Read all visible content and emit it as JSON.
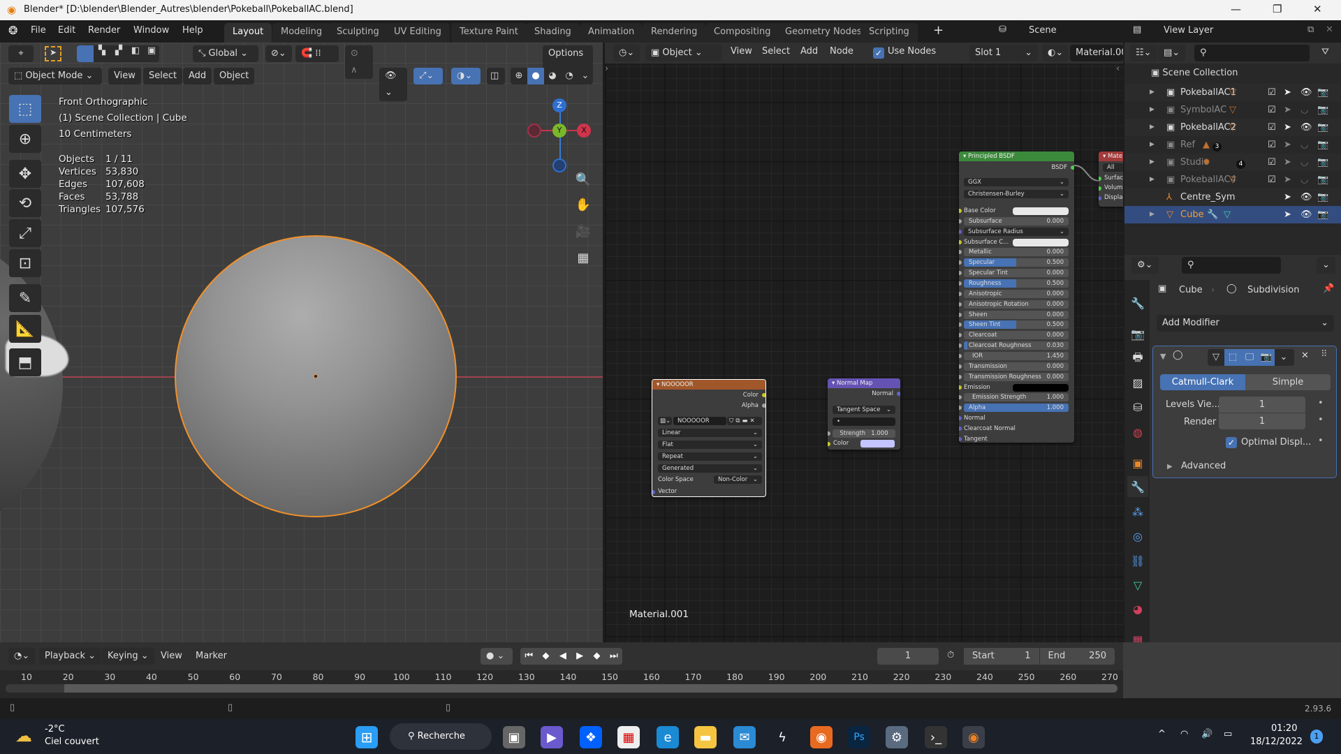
{
  "window": {
    "title": "Blender* [D:\\blender\\Blender_Autres\\blender\\Pokeball\\PokeballAC.blend]"
  },
  "menu": [
    "File",
    "Edit",
    "Render",
    "Window",
    "Help"
  ],
  "workspaces": [
    "Layout",
    "Modeling",
    "Sculpting",
    "UV Editing",
    "Texture Paint",
    "Shading",
    "Animation",
    "Rendering",
    "Compositing",
    "Geometry Nodes",
    "Scripting"
  ],
  "active_workspace": "Layout",
  "scene": "Scene",
  "view_layer": "View Layer",
  "viewport": {
    "transform": "Global",
    "options": "Options",
    "mode": "Object Mode",
    "menus": [
      "View",
      "Select",
      "Add",
      "Object"
    ],
    "overlay": {
      "view": "Front Orthographic",
      "collection": "(1) Scene Collection | Cube",
      "scale": "10 Centimeters",
      "stats": [
        {
          "label": "Objects",
          "value": "1 / 11"
        },
        {
          "label": "Vertices",
          "value": "53,830"
        },
        {
          "label": "Edges",
          "value": "107,608"
        },
        {
          "label": "Faces",
          "value": "53,788"
        },
        {
          "label": "Triangles",
          "value": "107,576"
        }
      ]
    },
    "gizmo": {
      "z": "Z",
      "y": "Y",
      "x": "X"
    },
    "selection_color": "#f0902a"
  },
  "node_editor": {
    "type": "Object",
    "menus": [
      "View",
      "Select",
      "Add",
      "Node"
    ],
    "use_nodes": "Use Nodes",
    "use_nodes_checked": true,
    "slot": "Slot 1",
    "material": "Material.00",
    "material_label": "Material.001",
    "image_node": {
      "title": "NOOOOOR",
      "outputs": [
        "Color",
        "Alpha"
      ],
      "image": "NOOOOOR",
      "interpolation": "Linear",
      "projection": "Flat",
      "extension": "Repeat",
      "source": "Generated",
      "color_space_label": "Color Space",
      "color_space": "Non-Color",
      "input": "Vector",
      "header_color": "#a0582b"
    },
    "normal_map": {
      "title": "Normal Map",
      "output": "Normal",
      "space": "Tangent Space",
      "uv": "•",
      "strength_label": "Strength",
      "strength": "1.000",
      "color_label": "Color",
      "color": "#c4c4ff",
      "header_color": "#6553b3"
    },
    "bsdf": {
      "title": "Principled BSDF",
      "output": "BSDF",
      "distribution": "GGX",
      "subsurface_method": "Christensen-Burley",
      "header_color": "#3b8a3b",
      "rows": [
        {
          "label": "Base Color",
          "kind": "color",
          "color": "#e8e8e8",
          "socket": "#c7c729"
        },
        {
          "label": "Subsurface",
          "value": "0.000",
          "kind": "slider",
          "fill": 0
        },
        {
          "label": "Subsurface Radius",
          "kind": "dropdown",
          "socket": "#6363c7"
        },
        {
          "label": "Subsurface C...",
          "kind": "color",
          "color": "#e8e8e8",
          "socket": "#c7c729"
        },
        {
          "label": "Metallic",
          "value": "0.000",
          "kind": "slider",
          "fill": 0
        },
        {
          "label": "Specular",
          "value": "0.500",
          "kind": "slider",
          "fill": 0.5
        },
        {
          "label": "Specular Tint",
          "value": "0.000",
          "kind": "slider",
          "fill": 0
        },
        {
          "label": "Roughness",
          "value": "0.500",
          "kind": "slider",
          "fill": 0.5
        },
        {
          "label": "Anisotropic",
          "value": "0.000",
          "kind": "slider",
          "fill": 0
        },
        {
          "label": "Anisotropic Rotation",
          "value": "0.000",
          "kind": "slider",
          "fill": 0
        },
        {
          "label": "Sheen",
          "value": "0.000",
          "kind": "slider",
          "fill": 0
        },
        {
          "label": "Sheen Tint",
          "value": "0.500",
          "kind": "slider",
          "fill": 0.5
        },
        {
          "label": "Clearcoat",
          "value": "0.000",
          "kind": "slider",
          "fill": 0
        },
        {
          "label": "Clearcoat Roughness",
          "value": "0.030",
          "kind": "slider",
          "fill": 0.03
        },
        {
          "label": "IOR",
          "value": "1.450",
          "kind": "number"
        },
        {
          "label": "Transmission",
          "value": "0.000",
          "kind": "slider",
          "fill": 0
        },
        {
          "label": "Transmission Roughness",
          "value": "0.000",
          "kind": "slider",
          "fill": 0
        },
        {
          "label": "Emission",
          "kind": "color",
          "color": "#000000",
          "socket": "#c7c729"
        },
        {
          "label": "Emission Strength",
          "value": "1.000",
          "kind": "number"
        },
        {
          "label": "Alpha",
          "value": "1.000",
          "kind": "slider",
          "fill": 1
        },
        {
          "label": "Normal",
          "kind": "socket",
          "socket": "#6363c7"
        },
        {
          "label": "Clearcoat Normal",
          "kind": "socket",
          "socket": "#6363c7"
        },
        {
          "label": "Tangent",
          "kind": "socket",
          "socket": "#6363c7"
        }
      ]
    },
    "output_node": {
      "title": "Mate",
      "target": "All",
      "sockets": [
        "Surfac",
        "Volum",
        "Displac"
      ],
      "header_color": "#a33a3a"
    }
  },
  "outliner": {
    "root": "Scene Collection",
    "rows": [
      {
        "name": "PokeballAC1",
        "dim": false,
        "expand": true,
        "type": "collection",
        "extra": "mesh-icon",
        "visible": true
      },
      {
        "name": "SymbolAC",
        "dim": true,
        "expand": true,
        "type": "collection",
        "extra": "mesh-icon",
        "visible": false
      },
      {
        "name": "PokeballAC2",
        "dim": false,
        "expand": true,
        "type": "collection",
        "extra": "mesh-icon",
        "visible": true
      },
      {
        "name": "Ref",
        "dim": true,
        "expand": true,
        "type": "collection",
        "extra": "image-icon",
        "badge": "3",
        "visible": false
      },
      {
        "name": "Studio",
        "dim": true,
        "expand": true,
        "type": "collection",
        "extra": "light-icon",
        "badge": "4",
        "visible": false
      },
      {
        "name": "PokeballAC4",
        "dim": true,
        "expand": true,
        "type": "collection",
        "extra": "mesh-icon",
        "visible": false
      },
      {
        "name": "Centre_Sym",
        "dim": false,
        "expand": false,
        "type": "empty",
        "visible": true
      },
      {
        "name": "Cube",
        "dim": false,
        "expand": true,
        "type": "mesh",
        "selected": true,
        "visible": true
      }
    ]
  },
  "properties": {
    "object": "Cube",
    "modifier": "Subdivision",
    "add_modifier": "Add Modifier",
    "methods": [
      "Catmull-Clark",
      "Simple"
    ],
    "active_method": "Catmull-Clark",
    "levels_label": "Levels Vie...",
    "levels": "1",
    "render_label": "Render",
    "render": "1",
    "optimal_label": "Optimal Displ...",
    "optimal_checked": true,
    "advanced": "Advanced"
  },
  "timeline": {
    "menus": [
      "Playback",
      "Keying",
      "View",
      "Marker"
    ],
    "current_frame": "1",
    "start_label": "Start",
    "start": "1",
    "end_label": "End",
    "end": "250",
    "ticks": [
      "10",
      "20",
      "30",
      "40",
      "50",
      "60",
      "70",
      "80",
      "90",
      "100",
      "110",
      "120",
      "130",
      "140",
      "150",
      "160",
      "170",
      "180",
      "190",
      "200",
      "210",
      "220",
      "230",
      "240",
      "250",
      "260",
      "270"
    ]
  },
  "status": {
    "version": "2.93.6"
  },
  "taskbar": {
    "temperature": "-2°C",
    "weather": "Ciel couvert",
    "search": "Recherche",
    "time": "01:20",
    "date": "18/12/2022",
    "notifications": "1"
  }
}
